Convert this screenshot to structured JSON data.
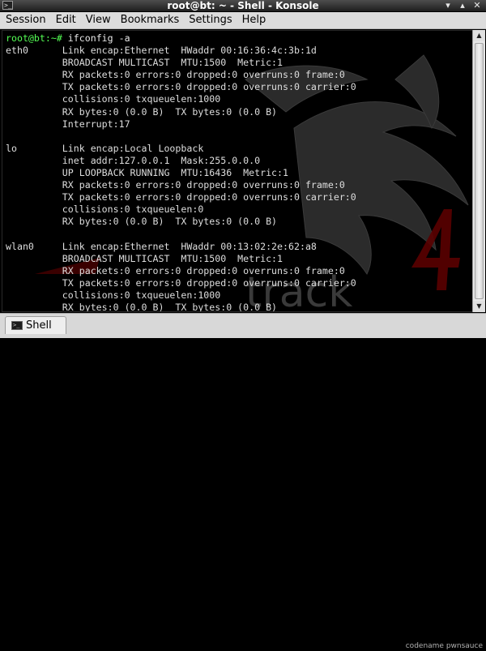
{
  "window": {
    "title": "root@bt: ~ - Shell - Konsole",
    "icon": "terminal-icon",
    "buttons": [
      {
        "name": "minimize-button",
        "glyph": "▾"
      },
      {
        "name": "maximize-button",
        "glyph": "▴"
      },
      {
        "name": "close-button",
        "glyph": "✕"
      }
    ]
  },
  "menubar": {
    "items": [
      "Session",
      "Edit",
      "View",
      "Bookmarks",
      "Settings",
      "Help"
    ]
  },
  "terminal": {
    "prompt": "root@bt:~#",
    "command": " ifconfig -a",
    "output": [
      "eth0      Link encap:Ethernet  HWaddr 00:16:36:4c:3b:1d",
      "          BROADCAST MULTICAST  MTU:1500  Metric:1",
      "          RX packets:0 errors:0 dropped:0 overruns:0 frame:0",
      "          TX packets:0 errors:0 dropped:0 overruns:0 carrier:0",
      "          collisions:0 txqueuelen:1000",
      "          RX bytes:0 (0.0 B)  TX bytes:0 (0.0 B)",
      "          Interrupt:17",
      "",
      "lo        Link encap:Local Loopback",
      "          inet addr:127.0.0.1  Mask:255.0.0.0",
      "          UP LOOPBACK RUNNING  MTU:16436  Metric:1",
      "          RX packets:0 errors:0 dropped:0 overruns:0 frame:0",
      "          TX packets:0 errors:0 dropped:0 overruns:0 carrier:0",
      "          collisions:0 txqueuelen:0",
      "          RX bytes:0 (0.0 B)  TX bytes:0 (0.0 B)",
      "",
      "wlan0     Link encap:Ethernet  HWaddr 00:13:02:2e:62:a8",
      "          BROADCAST MULTICAST  MTU:1500  Metric:1",
      "          RX packets:0 errors:0 dropped:0 overruns:0 frame:0",
      "          TX packets:0 errors:0 dropped:0 overruns:0 carrier:0",
      "          collisions:0 txqueuelen:1000",
      "          RX bytes:0 (0.0 B)  TX bytes:0 (0.0 B)"
    ],
    "background_brand": "back|track 4",
    "colors": {
      "prompt": "#54ff54",
      "text": "#dedede",
      "background": "#000000"
    }
  },
  "tabbar": {
    "tabs": [
      {
        "label": "Shell",
        "icon": "terminal-icon"
      }
    ]
  },
  "taskbar_fragment": "codename pwnsauce"
}
